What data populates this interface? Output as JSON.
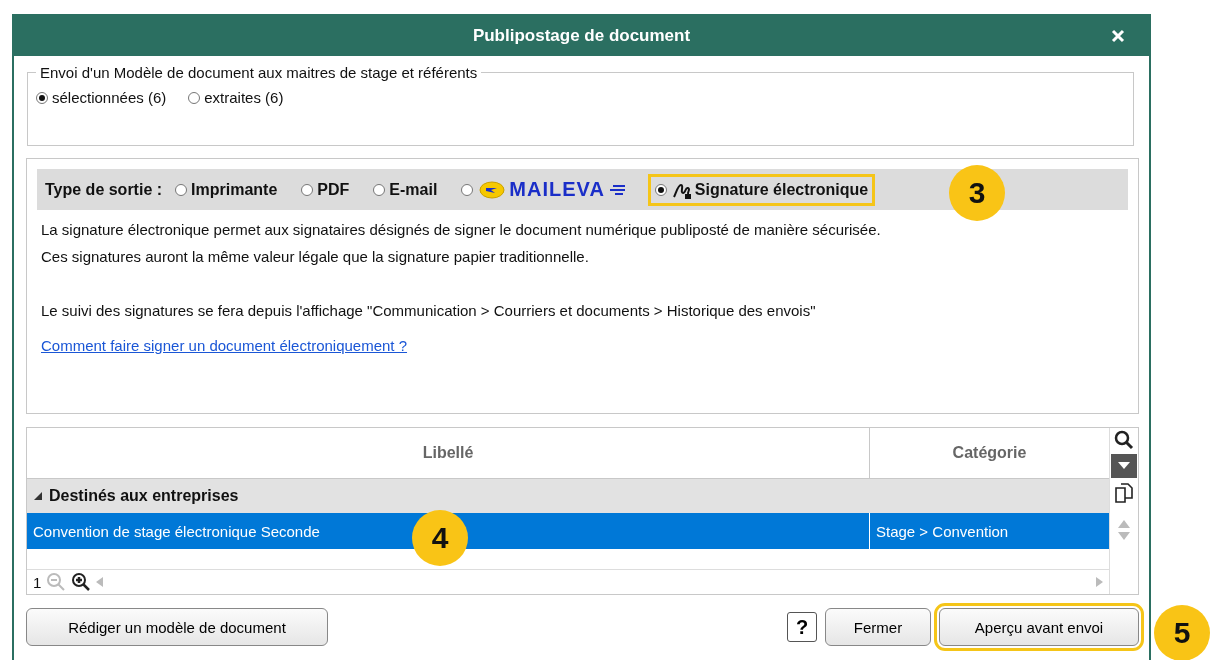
{
  "window": {
    "title": "Publipostage de document"
  },
  "recipients": {
    "legend": "Envoi d'un Modèle de document aux maitres de stage et référents",
    "options": [
      {
        "label": "sélectionnées (6)",
        "selected": true
      },
      {
        "label": "extraites (6)",
        "selected": false
      }
    ]
  },
  "output": {
    "label": "Type de sortie :",
    "options": [
      {
        "kind": "text",
        "label": "Imprimante",
        "selected": false,
        "highlighted": false
      },
      {
        "kind": "text",
        "label": "PDF",
        "selected": false,
        "highlighted": false
      },
      {
        "kind": "text",
        "label": "E-mail",
        "selected": false,
        "highlighted": false
      },
      {
        "kind": "maileva",
        "label": "MAILEVA",
        "selected": false,
        "highlighted": false
      },
      {
        "kind": "signature",
        "label": "Signature électronique",
        "selected": true,
        "highlighted": true
      }
    ],
    "description": [
      "La signature électronique permet aux signataires désignés de signer le document numérique publiposté de manière sécurisée.",
      "Ces signatures auront la même valeur légale que la signature papier traditionnelle."
    ],
    "note": "Le suivi des signatures se fera depuis l'affichage \"Communication > Courriers et documents > Historique des envois\"",
    "link": "Comment faire signer un document électroniquement ?"
  },
  "table": {
    "columns": [
      "Libellé",
      "Catégorie"
    ],
    "groups": [
      {
        "label": "Destinés aux entreprises",
        "expanded": true,
        "rows": [
          {
            "cells": [
              "Convention de stage électronique Seconde",
              "Stage > Convention"
            ],
            "selected": true
          }
        ]
      }
    ],
    "page": "1"
  },
  "buttons": {
    "compose": "Rédiger un modèle de document",
    "help": "?",
    "close": "Fermer",
    "preview": "Aperçu avant envoi",
    "preview_highlighted": true
  },
  "callouts": [
    "3",
    "4",
    "5"
  ]
}
